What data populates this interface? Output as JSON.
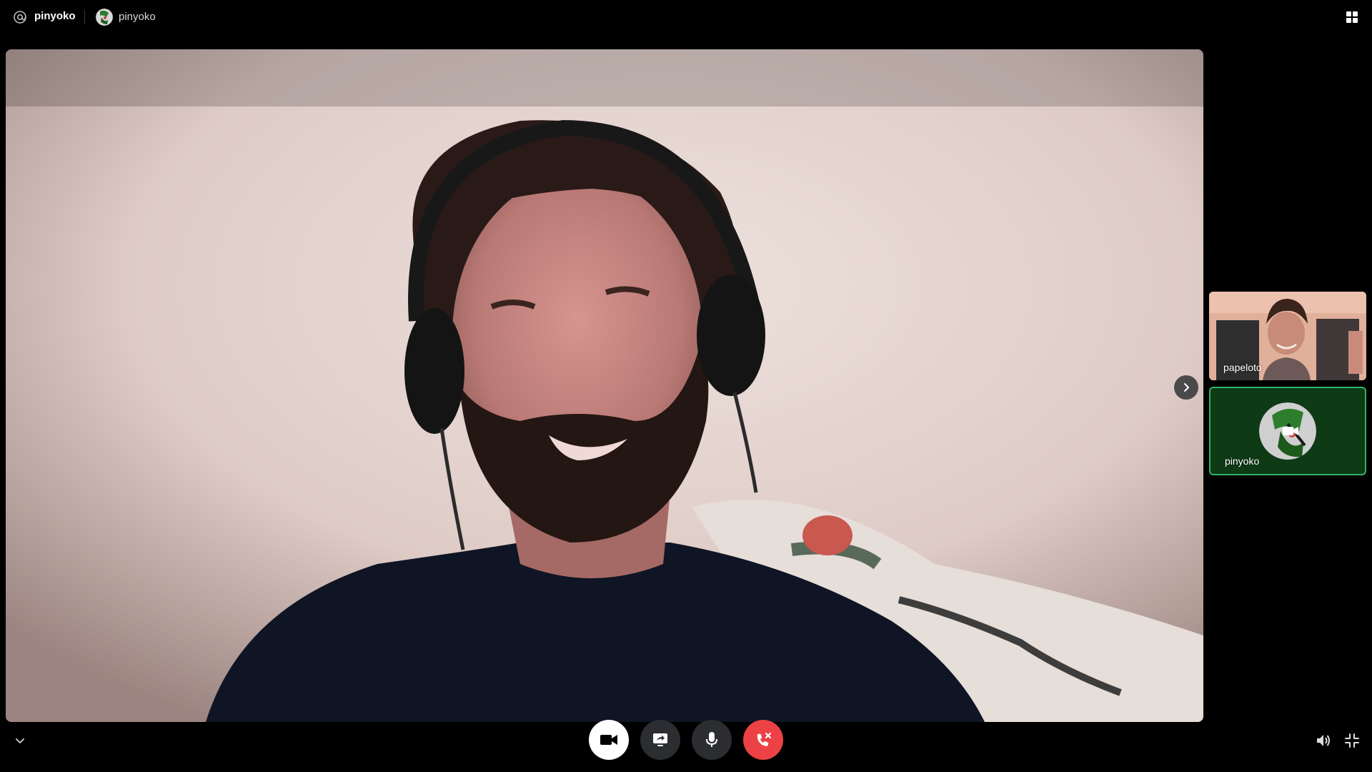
{
  "header": {
    "channel_name": "pinyoko",
    "user_name": "pinyoko",
    "icons": {
      "mention": "at-icon",
      "layout": "grid-icon"
    }
  },
  "main_video": {
    "speaker": "papeloto",
    "description_icon": "video-feed"
  },
  "participants": [
    {
      "name": "papeloto",
      "has_video": true
    },
    {
      "name": "pinyoko",
      "has_video": false,
      "speaking": true
    }
  ],
  "controls": {
    "buttons": [
      "video-toggle",
      "screen-share",
      "microphone",
      "leave-call"
    ],
    "icons": {
      "collapse": "chevron-down-icon",
      "next": "chevron-right-icon",
      "volume": "speaker-icon",
      "exit_fullscreen": "minimize-icon"
    }
  },
  "colors": {
    "background": "#000000",
    "control_dark": "#2b2d31",
    "leave_red": "#ed4245",
    "speaking_green": "#2fb36a",
    "tile_green": "#0e3a16"
  }
}
